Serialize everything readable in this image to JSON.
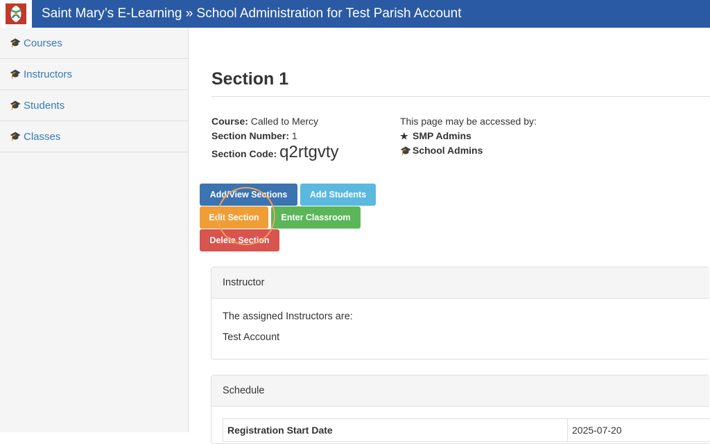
{
  "header": {
    "title": "Saint Mary’s E-Learning » School Administration for Test Parish Account"
  },
  "sidebar": {
    "items": [
      {
        "label": "Courses"
      },
      {
        "label": "Instructors"
      },
      {
        "label": "Students"
      },
      {
        "label": "Classes"
      }
    ]
  },
  "section": {
    "title": "Section 1",
    "course_label": "Course:",
    "course_value": "Called to Mercy",
    "number_label": "Section Number:",
    "number_value": "1",
    "code_label": "Section Code:",
    "code_value": "q2rtgvty"
  },
  "access": {
    "intro": "This page may be accessed by:",
    "roles": [
      "SMP Admins",
      "School Admins"
    ]
  },
  "buttons": {
    "add_view_sections": "Add/View Sections",
    "add_students": "Add Students",
    "edit_section": "Edit Section",
    "enter_classroom": "Enter Classroom",
    "delete_section": "Delete Section"
  },
  "instructor_panel": {
    "heading": "Instructor",
    "intro": "The assigned Instructors are:",
    "name": "Test Account"
  },
  "schedule_panel": {
    "heading": "Schedule",
    "rows": [
      {
        "label": "Registration Start Date",
        "value": "2025-07-20"
      }
    ]
  },
  "colors": {
    "header_bg": "#2a5aa4",
    "link": "#337ab7",
    "primary": "#3c73b1",
    "info": "#5bb8df",
    "warning": "#ef9e36",
    "success": "#5bb65a",
    "danger": "#d9534f"
  },
  "icons": {
    "sidebar": "graduation-cap-icon",
    "smp_admins": "star-icon",
    "school_admins": "graduation-cap-icon"
  }
}
